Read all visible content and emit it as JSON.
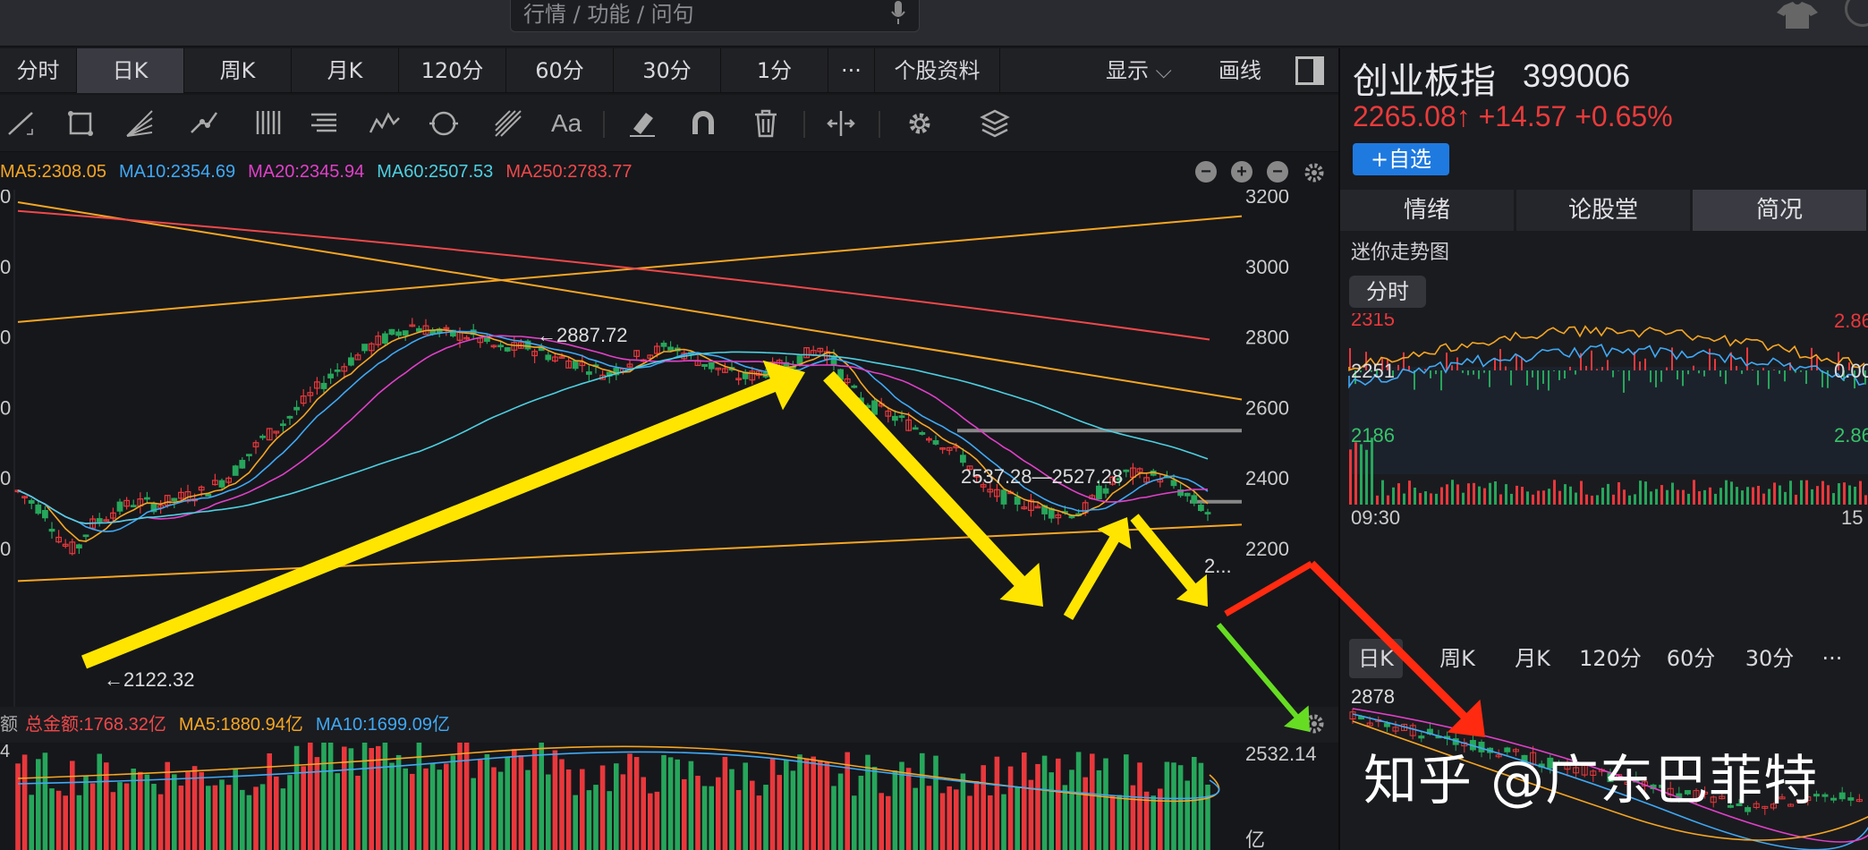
{
  "topbar": {
    "search_placeholder": "行情 / 功能 / 问句",
    "icons": [
      "mic-icon",
      "shirt-icon"
    ]
  },
  "period_tabs": [
    {
      "label": "分时",
      "active": false
    },
    {
      "label": "日K",
      "active": true
    },
    {
      "label": "周K",
      "active": false
    },
    {
      "label": "月K",
      "active": false
    },
    {
      "label": "120分",
      "active": false
    },
    {
      "label": "60分",
      "active": false
    },
    {
      "label": "30分",
      "active": false
    },
    {
      "label": "1分",
      "active": false
    },
    {
      "label": "···",
      "active": false
    },
    {
      "label": "个股资料",
      "active": false
    }
  ],
  "toolbar": {
    "display_label": "显示",
    "draw_label": "画线"
  },
  "draw_tools": [
    "line-tool-icon",
    "rect-tool-icon",
    "fan-tool-icon",
    "segment-tool-icon",
    "channel-tool-icon",
    "fib-tool-icon",
    "wave-tool-icon",
    "cycle-tool-icon",
    "gann-tool-icon",
    "text-tool-icon",
    "eraser-icon",
    "magnet-icon",
    "trash-icon",
    "scale-icon",
    "gear-icon",
    "layers-icon"
  ],
  "text_tool_label": "Aa",
  "ma_legend": [
    {
      "label": "MA5:2308.05",
      "color": "#f5a623"
    },
    {
      "label": "MA10:2354.69",
      "color": "#3fa9f5"
    },
    {
      "label": "MA20:2345.94",
      "color": "#e040c8"
    },
    {
      "label": "MA60:2507.53",
      "color": "#4dd0e1"
    },
    {
      "label": "MA250:2783.77",
      "color": "#f0484a"
    }
  ],
  "main_chart": {
    "y_ticks": [
      "3200",
      "3000",
      "2800",
      "2600",
      "2400",
      "2200"
    ],
    "left_ticks": [
      "0",
      "0",
      "0",
      "0",
      "0",
      "0"
    ],
    "annotations": {
      "high": "←2887.72",
      "low": "←2122.32",
      "range": "2537.28—2527.28",
      "right": "2..."
    }
  },
  "volume": {
    "legend_prefix": "额",
    "legend": [
      {
        "label": "总金额:1768.32亿",
        "color": "#f0484a"
      },
      {
        "label": "MA5:1880.94亿",
        "color": "#f5a623"
      },
      {
        "label": "MA10:1699.09亿",
        "color": "#3fa9f5"
      }
    ],
    "left_tick": "4",
    "y_top": "2532.14",
    "y_unit": "亿"
  },
  "right_panel": {
    "stock_name": "创业板指",
    "stock_code": "399006",
    "price": "2265.08↑",
    "change": "+14.57",
    "change_pct": "+0.65%",
    "fav_label": "+自选",
    "tabs": [
      {
        "label": "情绪",
        "active": false
      },
      {
        "label": "论股堂",
        "active": false
      },
      {
        "label": "简况",
        "active": true
      }
    ],
    "mini_title": "迷你走势图",
    "mini_btn": "分时",
    "mini_labels": {
      "top_left": "2315",
      "top_right": "2.86",
      "mid_left": "2251",
      "mid_right": "0.00",
      "low_left": "2186",
      "low_right": "2.86",
      "time_left": "09:30",
      "time_right": "15"
    },
    "mini_tabs": [
      {
        "label": "日K",
        "active": true
      },
      {
        "label": "周K",
        "active": false
      },
      {
        "label": "月K",
        "active": false
      },
      {
        "label": "120分",
        "active": false
      },
      {
        "label": "60分",
        "active": false
      },
      {
        "label": "30分",
        "active": false
      },
      {
        "label": "···",
        "active": false
      }
    ],
    "mini_k_top": "2878"
  },
  "watermark": "知乎 @广东巴菲特",
  "colors": {
    "up": "#e8383c",
    "down": "#26a65b",
    "arrow_yellow": "#ffe500",
    "arrow_red": "#ff2a10",
    "arrow_green": "#66dd22",
    "trend_line": "#f5a623"
  }
}
